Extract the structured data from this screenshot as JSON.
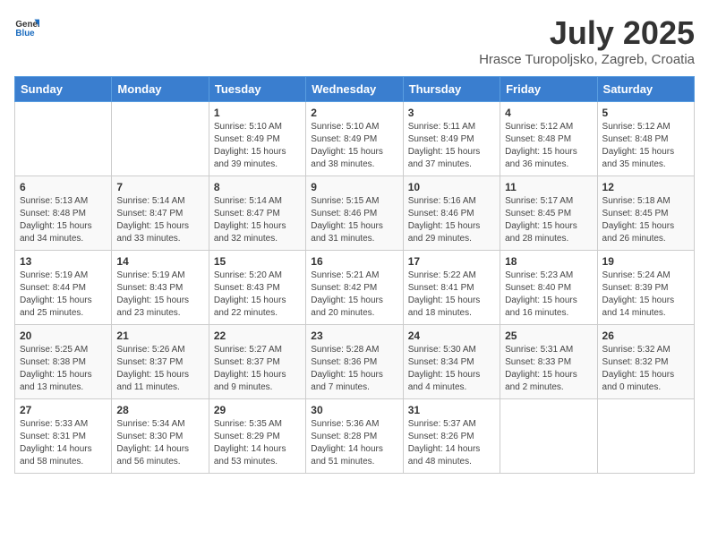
{
  "header": {
    "logo_general": "General",
    "logo_blue": "Blue",
    "title": "July 2025",
    "subtitle": "Hrasce Turopoljsko, Zagreb, Croatia"
  },
  "days_of_week": [
    "Sunday",
    "Monday",
    "Tuesday",
    "Wednesday",
    "Thursday",
    "Friday",
    "Saturday"
  ],
  "weeks": [
    [
      {
        "day": "",
        "info": ""
      },
      {
        "day": "",
        "info": ""
      },
      {
        "day": "1",
        "info": "Sunrise: 5:10 AM\nSunset: 8:49 PM\nDaylight: 15 hours and 39 minutes."
      },
      {
        "day": "2",
        "info": "Sunrise: 5:10 AM\nSunset: 8:49 PM\nDaylight: 15 hours and 38 minutes."
      },
      {
        "day": "3",
        "info": "Sunrise: 5:11 AM\nSunset: 8:49 PM\nDaylight: 15 hours and 37 minutes."
      },
      {
        "day": "4",
        "info": "Sunrise: 5:12 AM\nSunset: 8:48 PM\nDaylight: 15 hours and 36 minutes."
      },
      {
        "day": "5",
        "info": "Sunrise: 5:12 AM\nSunset: 8:48 PM\nDaylight: 15 hours and 35 minutes."
      }
    ],
    [
      {
        "day": "6",
        "info": "Sunrise: 5:13 AM\nSunset: 8:48 PM\nDaylight: 15 hours and 34 minutes."
      },
      {
        "day": "7",
        "info": "Sunrise: 5:14 AM\nSunset: 8:47 PM\nDaylight: 15 hours and 33 minutes."
      },
      {
        "day": "8",
        "info": "Sunrise: 5:14 AM\nSunset: 8:47 PM\nDaylight: 15 hours and 32 minutes."
      },
      {
        "day": "9",
        "info": "Sunrise: 5:15 AM\nSunset: 8:46 PM\nDaylight: 15 hours and 31 minutes."
      },
      {
        "day": "10",
        "info": "Sunrise: 5:16 AM\nSunset: 8:46 PM\nDaylight: 15 hours and 29 minutes."
      },
      {
        "day": "11",
        "info": "Sunrise: 5:17 AM\nSunset: 8:45 PM\nDaylight: 15 hours and 28 minutes."
      },
      {
        "day": "12",
        "info": "Sunrise: 5:18 AM\nSunset: 8:45 PM\nDaylight: 15 hours and 26 minutes."
      }
    ],
    [
      {
        "day": "13",
        "info": "Sunrise: 5:19 AM\nSunset: 8:44 PM\nDaylight: 15 hours and 25 minutes."
      },
      {
        "day": "14",
        "info": "Sunrise: 5:19 AM\nSunset: 8:43 PM\nDaylight: 15 hours and 23 minutes."
      },
      {
        "day": "15",
        "info": "Sunrise: 5:20 AM\nSunset: 8:43 PM\nDaylight: 15 hours and 22 minutes."
      },
      {
        "day": "16",
        "info": "Sunrise: 5:21 AM\nSunset: 8:42 PM\nDaylight: 15 hours and 20 minutes."
      },
      {
        "day": "17",
        "info": "Sunrise: 5:22 AM\nSunset: 8:41 PM\nDaylight: 15 hours and 18 minutes."
      },
      {
        "day": "18",
        "info": "Sunrise: 5:23 AM\nSunset: 8:40 PM\nDaylight: 15 hours and 16 minutes."
      },
      {
        "day": "19",
        "info": "Sunrise: 5:24 AM\nSunset: 8:39 PM\nDaylight: 15 hours and 14 minutes."
      }
    ],
    [
      {
        "day": "20",
        "info": "Sunrise: 5:25 AM\nSunset: 8:38 PM\nDaylight: 15 hours and 13 minutes."
      },
      {
        "day": "21",
        "info": "Sunrise: 5:26 AM\nSunset: 8:37 PM\nDaylight: 15 hours and 11 minutes."
      },
      {
        "day": "22",
        "info": "Sunrise: 5:27 AM\nSunset: 8:37 PM\nDaylight: 15 hours and 9 minutes."
      },
      {
        "day": "23",
        "info": "Sunrise: 5:28 AM\nSunset: 8:36 PM\nDaylight: 15 hours and 7 minutes."
      },
      {
        "day": "24",
        "info": "Sunrise: 5:30 AM\nSunset: 8:34 PM\nDaylight: 15 hours and 4 minutes."
      },
      {
        "day": "25",
        "info": "Sunrise: 5:31 AM\nSunset: 8:33 PM\nDaylight: 15 hours and 2 minutes."
      },
      {
        "day": "26",
        "info": "Sunrise: 5:32 AM\nSunset: 8:32 PM\nDaylight: 15 hours and 0 minutes."
      }
    ],
    [
      {
        "day": "27",
        "info": "Sunrise: 5:33 AM\nSunset: 8:31 PM\nDaylight: 14 hours and 58 minutes."
      },
      {
        "day": "28",
        "info": "Sunrise: 5:34 AM\nSunset: 8:30 PM\nDaylight: 14 hours and 56 minutes."
      },
      {
        "day": "29",
        "info": "Sunrise: 5:35 AM\nSunset: 8:29 PM\nDaylight: 14 hours and 53 minutes."
      },
      {
        "day": "30",
        "info": "Sunrise: 5:36 AM\nSunset: 8:28 PM\nDaylight: 14 hours and 51 minutes."
      },
      {
        "day": "31",
        "info": "Sunrise: 5:37 AM\nSunset: 8:26 PM\nDaylight: 14 hours and 48 minutes."
      },
      {
        "day": "",
        "info": ""
      },
      {
        "day": "",
        "info": ""
      }
    ]
  ]
}
